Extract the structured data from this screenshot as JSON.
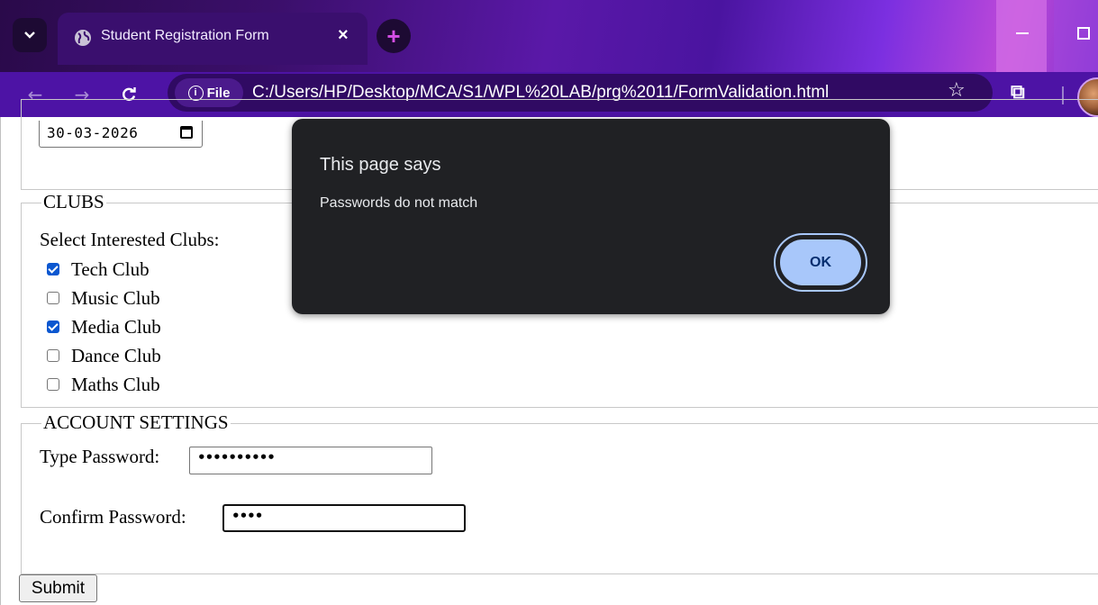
{
  "browser": {
    "tab_title": "Student Registration Form",
    "tab_close": "×",
    "new_tab": "+",
    "site_chip_label": "File",
    "url": "C:/Users/HP/Desktop/MCA/S1/WPL%20LAB/prg%2011/FormValidation.html",
    "accent_color": "#4d13a5"
  },
  "form": {
    "date_value": "30-03-2026",
    "clubs": {
      "legend": "CLUBS",
      "prompt": "Select Interested Clubs:",
      "items": [
        {
          "label": "Tech Club",
          "checked": true
        },
        {
          "label": "Music Club",
          "checked": false
        },
        {
          "label": "Media Club",
          "checked": true
        },
        {
          "label": "Dance Club",
          "checked": false
        },
        {
          "label": "Maths Club",
          "checked": false
        }
      ]
    },
    "account": {
      "legend": "ACCOUNT SETTINGS",
      "password_label": "Type Password:",
      "password_mask": "••••••••••",
      "confirm_label": "Confirm Password:",
      "confirm_mask": "••••"
    },
    "submit_label": "Submit"
  },
  "dialog": {
    "title": "This page says",
    "message": "Passwords do not match",
    "ok_label": "OK"
  }
}
